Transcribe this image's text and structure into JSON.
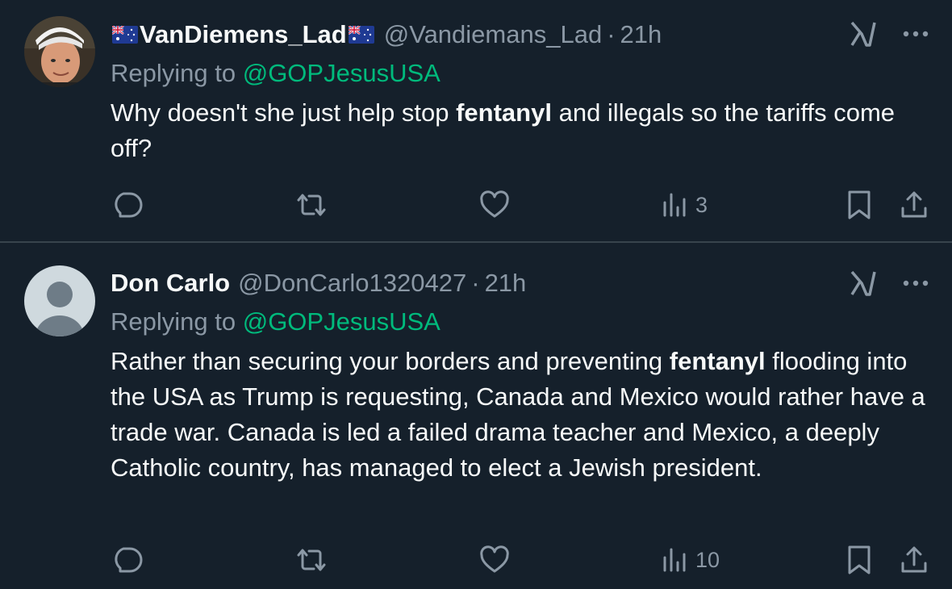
{
  "tweets": [
    {
      "author": {
        "name": "VanDiemens_Lad",
        "handle": "@Vandiemans_Lad",
        "has_flags": true
      },
      "time": "21h",
      "replying_prefix": "Replying to",
      "replying_to": "@GOPJesusUSA",
      "text_parts": [
        {
          "text": "Why doesn't she just help stop ",
          "bold": false
        },
        {
          "text": "fentanyl",
          "bold": true
        },
        {
          "text": " and illegals so the tariffs come off?",
          "bold": false
        }
      ],
      "views": "3"
    },
    {
      "author": {
        "name": "Don Carlo",
        "handle": "@DonCarlo1320427",
        "has_flags": false
      },
      "time": "21h",
      "replying_prefix": "Replying to",
      "replying_to": "@GOPJesusUSA",
      "text_parts": [
        {
          "text": "Rather than securing your borders and preventing ",
          "bold": false
        },
        {
          "text": "fentanyl",
          "bold": true
        },
        {
          "text": " flooding into the USA as Trump is requesting, Canada and Mexico would rather have a trade war. Canada is led a failed drama teacher and Mexico, a deeply Catholic country, has managed to elect a Jewish president.",
          "bold": false
        }
      ],
      "views": "10"
    }
  ],
  "colors": {
    "background": "#15202b",
    "text": "#f7f9f9",
    "muted": "#8b98a5",
    "mention": "#00ba7c",
    "divider": "#38444d"
  },
  "icons": [
    "reply-icon",
    "retweet-icon",
    "like-icon",
    "views-icon",
    "bookmark-icon",
    "share-icon",
    "grok-icon",
    "more-icon"
  ]
}
